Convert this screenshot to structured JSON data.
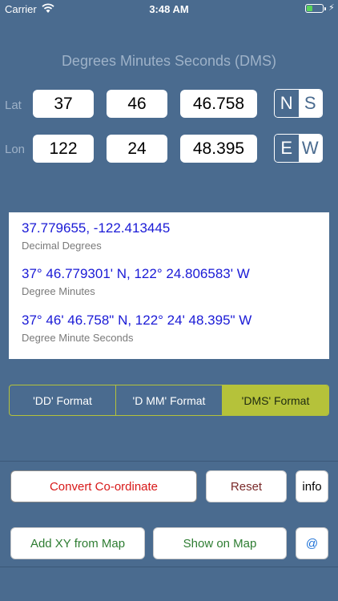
{
  "status": {
    "carrier": "Carrier",
    "time": "3:48 AM",
    "battery_level": 0.38
  },
  "title": "Degrees Minutes Seconds (DMS)",
  "lat": {
    "label": "Lat",
    "deg": "37",
    "min": "46",
    "sec": "46.758",
    "hemi": [
      "N",
      "S"
    ]
  },
  "lon": {
    "label": "Lon",
    "deg": "122",
    "min": "24",
    "sec": "48.395",
    "hemi": [
      "E",
      "W"
    ]
  },
  "results": [
    {
      "value": "37.779655, -122.413445",
      "label": "Decimal Degrees"
    },
    {
      "value": "37° 46.779301' N, 122° 24.806583' W",
      "label": "Degree Minutes"
    },
    {
      "value": "37° 46' 46.758\" N, 122° 24' 48.395\" W",
      "label": "Degree Minute Seconds"
    }
  ],
  "formats": [
    "'DD' Format",
    "'D MM' Format",
    "'DMS' Format"
  ],
  "buttons": {
    "convert": "Convert Co-ordinate",
    "reset": "Reset",
    "info": "info",
    "add_xy": "Add XY from Map",
    "show_map": "Show on Map",
    "email": "@"
  },
  "colors": {
    "background": "#4a6b8f",
    "accent": "#b5c23a",
    "convert_text": "#d81818",
    "reset_text": "#7a2a2a",
    "green_text": "#2e7d32",
    "blue_text": "#1a6fd6"
  }
}
